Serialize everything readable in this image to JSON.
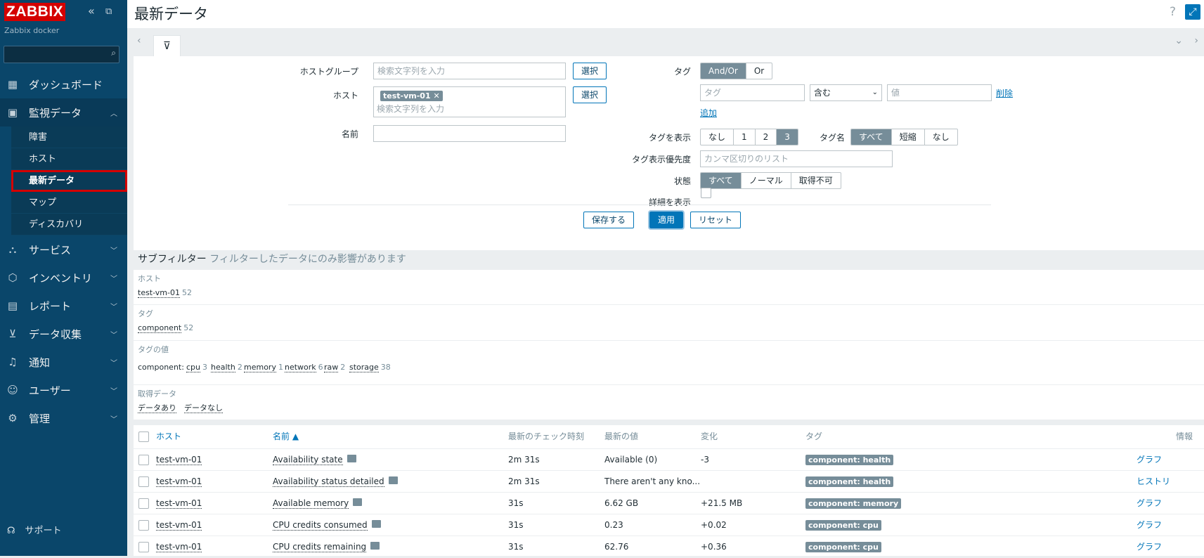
{
  "sidebar": {
    "logo": "ZABBIX",
    "server": "Zabbix docker",
    "menu": [
      {
        "label": "ダッシュボード"
      },
      {
        "label": "監視データ"
      },
      {
        "label": "サービス"
      },
      {
        "label": "インベントリ"
      },
      {
        "label": "レポート"
      },
      {
        "label": "データ収集"
      },
      {
        "label": "通知"
      },
      {
        "label": "ユーザー"
      },
      {
        "label": "管理"
      }
    ],
    "submenu": [
      "障害",
      "ホスト",
      "最新データ",
      "マップ",
      "ディスカバリ"
    ],
    "support": "サポート"
  },
  "header": {
    "title": "最新データ",
    "help": "?"
  },
  "filter": {
    "hostgroup_label": "ホストグループ",
    "hostgroup_placeholder": "検索文字列を入力",
    "select_label": "選択",
    "host_label": "ホスト",
    "host_chip": "test-vm-01",
    "host_placeholder": "検索文字列を入力",
    "name_label": "名前",
    "tag_label": "タグ",
    "tag_andor": [
      "And/Or",
      "Or"
    ],
    "tag_placeholder": "タグ",
    "tag_operator": "含む",
    "tag_value_placeholder": "値",
    "tag_remove": "削除",
    "tag_add": "追加",
    "show_tags_label": "タグを表示",
    "show_tags_options": [
      "なし",
      "1",
      "2",
      "3"
    ],
    "tag_name_label": "タグ名",
    "tag_name_options": [
      "すべて",
      "短縮",
      "なし"
    ],
    "tag_priority_label": "タグ表示優先度",
    "tag_priority_placeholder": "カンマ区切りのリスト",
    "state_label": "状態",
    "state_options": [
      "すべて",
      "ノーマル",
      "取得不可"
    ],
    "details_label": "詳細を表示",
    "save_label": "保存する",
    "apply_label": "適用",
    "reset_label": "リセット"
  },
  "subfilter": {
    "title": "サブフィルター",
    "note": "フィルターしたデータにのみ影響があります",
    "host_head": "ホスト",
    "host_item": "test-vm-01",
    "host_count": "52",
    "tag_head": "タグ",
    "tag_item": "component",
    "tag_count": "52",
    "tagval_head": "タグの値",
    "tagval_prefix": "component:",
    "tag_values": [
      {
        "name": "cpu",
        "count": "3"
      },
      {
        "name": "health",
        "count": "2"
      },
      {
        "name": "memory",
        "count": "1"
      },
      {
        "name": "network",
        "count": "6"
      },
      {
        "name": "raw",
        "count": "2"
      },
      {
        "name": "storage",
        "count": "38"
      }
    ],
    "data_head": "取得データ",
    "data_with": "データあり",
    "data_without": "データなし"
  },
  "table": {
    "headers": {
      "host": "ホスト",
      "name": "名前 ▲",
      "lastcheck": "最新のチェック時刻",
      "lastvalue": "最新の値",
      "change": "変化",
      "tags": "タグ",
      "info": "情報"
    },
    "rows": [
      {
        "host": "test-vm-01",
        "name": "Availability state",
        "lastcheck": "2m 31s",
        "lastvalue": "Available (0)",
        "change": "-3",
        "tag": "component: health",
        "action": "グラフ"
      },
      {
        "host": "test-vm-01",
        "name": "Availability status detailed",
        "lastcheck": "2m 31s",
        "lastvalue": "There aren't any kno...",
        "change": "",
        "tag": "component: health",
        "action": "ヒストリ"
      },
      {
        "host": "test-vm-01",
        "name": "Available memory",
        "lastcheck": "31s",
        "lastvalue": "6.62 GB",
        "change": "+21.5 MB",
        "tag": "component: memory",
        "action": "グラフ"
      },
      {
        "host": "test-vm-01",
        "name": "CPU credits consumed",
        "lastcheck": "31s",
        "lastvalue": "0.23",
        "change": "+0.02",
        "tag": "component: cpu",
        "action": "グラフ"
      },
      {
        "host": "test-vm-01",
        "name": "CPU credits remaining",
        "lastcheck": "31s",
        "lastvalue": "62.76",
        "change": "+0.36",
        "tag": "component: cpu",
        "action": "グラフ"
      }
    ]
  }
}
